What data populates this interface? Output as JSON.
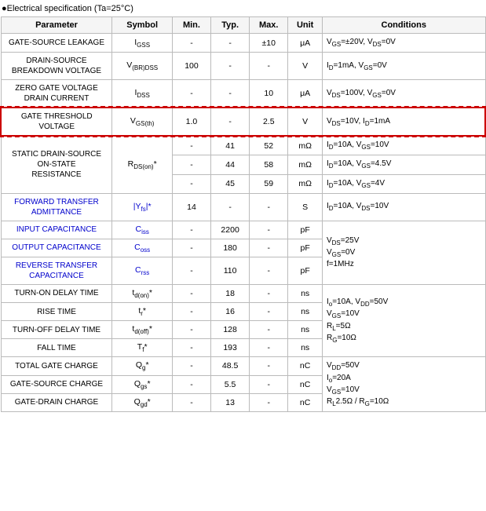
{
  "header": {
    "title": "●Electrical specification (Ta=25°C)"
  },
  "table": {
    "columns": [
      "Parameter",
      "Symbol",
      "Min.",
      "Typ.",
      "Max.",
      "Unit",
      "Conditions"
    ],
    "rows": [
      {
        "id": "gate-source-leakage",
        "param": "GATE-SOURCE LEAKAGE",
        "symbol": "IGSS",
        "min": "-",
        "typ": "-",
        "max": "±10",
        "unit": "μA",
        "conditions": "VGS=±20V, VDS=0V",
        "highlight": false,
        "blue": false,
        "colspan_param": 1
      },
      {
        "id": "drain-source-breakdown",
        "param": "DRAIN-SOURCE BREAKDOWN VOLTAGE",
        "symbol": "V(BR)DSS",
        "min": "100",
        "typ": "-",
        "max": "-",
        "unit": "V",
        "conditions": "ID=1mA, VGS=0V",
        "highlight": false,
        "blue": false
      },
      {
        "id": "zero-gate-voltage",
        "param": "ZERO GATE VOLTAGE DRAIN CURRENT",
        "symbol": "IDSS",
        "min": "-",
        "typ": "-",
        "max": "10",
        "unit": "μA",
        "conditions": "VDS=100V, VGS=0V",
        "highlight": false,
        "blue": false
      },
      {
        "id": "gate-threshold",
        "param": "GATE THRESHOLD VOLTAGE",
        "symbol": "VGS(th)",
        "min": "1.0",
        "typ": "-",
        "max": "2.5",
        "unit": "V",
        "conditions": "VDS=10V, ID=1mA",
        "highlight": true,
        "blue": false
      },
      {
        "id": "static-drain-1",
        "param": "STATIC DRAIN-SOURCE ON-STATE RESISTANCE",
        "symbol": "RDS(on)*",
        "min": "-",
        "typ": "41",
        "max": "52",
        "unit": "mΩ",
        "conditions": "ID=10A, VGS=10V",
        "highlight": false,
        "blue": false,
        "row_span": 3,
        "row_index": 0
      },
      {
        "id": "static-drain-2",
        "param": null,
        "symbol": null,
        "min": "-",
        "typ": "44",
        "max": "58",
        "unit": "mΩ",
        "conditions": "ID=10A, VGS=4.5V",
        "highlight": false,
        "blue": false,
        "row_span": 3,
        "row_index": 1
      },
      {
        "id": "static-drain-3",
        "param": null,
        "symbol": null,
        "min": "-",
        "typ": "45",
        "max": "59",
        "unit": "mΩ",
        "conditions": "ID=10A, VGS=4V",
        "highlight": false,
        "blue": false,
        "row_span": 3,
        "row_index": 2
      },
      {
        "id": "forward-transfer",
        "param": "FORWARD TRANSFER ADMITTANCE",
        "symbol": "|Yfs|*",
        "min": "14",
        "typ": "-",
        "max": "-",
        "unit": "S",
        "conditions": "ID=10A, VDS=10V",
        "highlight": false,
        "blue": true
      },
      {
        "id": "input-capacitance",
        "param": "INPUT CAPACITANCE",
        "symbol": "Ciss",
        "min": "-",
        "typ": "2200",
        "max": "-",
        "unit": "pF",
        "conditions": "",
        "highlight": false,
        "blue": true,
        "conditions_rowspan": 3
      },
      {
        "id": "output-capacitance",
        "param": "OUTPUT CAPACITANCE",
        "symbol": "Coss",
        "min": "-",
        "typ": "180",
        "max": "-",
        "unit": "pF",
        "conditions": "",
        "highlight": false,
        "blue": true
      },
      {
        "id": "reverse-transfer",
        "param": "REVERSE TRANSFER CAPACITANCE",
        "symbol": "Crss",
        "min": "-",
        "typ": "110",
        "max": "-",
        "unit": "pF",
        "conditions": "",
        "highlight": false,
        "blue": true
      },
      {
        "id": "turn-on-delay",
        "param": "TURN-ON DELAY TIME",
        "symbol": "td(on)*",
        "min": "-",
        "typ": "18",
        "max": "-",
        "unit": "ns",
        "conditions": "",
        "highlight": false,
        "blue": false,
        "conditions_rowspan": 4
      },
      {
        "id": "rise-time",
        "param": "RISE TIME",
        "symbol": "tr*",
        "min": "-",
        "typ": "16",
        "max": "-",
        "unit": "ns",
        "conditions": "",
        "highlight": false,
        "blue": false
      },
      {
        "id": "turn-off-delay",
        "param": "TURN-OFF DELAY TIME",
        "symbol": "td(off)*",
        "min": "-",
        "typ": "128",
        "max": "-",
        "unit": "ns",
        "conditions": "",
        "highlight": false,
        "blue": false
      },
      {
        "id": "fall-time",
        "param": "FALL TIME",
        "symbol": "Tf*",
        "min": "-",
        "typ": "193",
        "max": "-",
        "unit": "ns",
        "conditions": "",
        "highlight": false,
        "blue": false
      },
      {
        "id": "total-gate-charge",
        "param": "TOTAL GATE CHARGE",
        "symbol": "Qg*",
        "min": "-",
        "typ": "48.5",
        "max": "-",
        "unit": "nC",
        "conditions": "",
        "highlight": false,
        "blue": false,
        "conditions_rowspan": 3
      },
      {
        "id": "gate-source-charge",
        "param": "GATE-SOURCE CHARGE",
        "symbol": "Qgs*",
        "min": "-",
        "typ": "5.5",
        "max": "-",
        "unit": "nC",
        "conditions": "",
        "highlight": false,
        "blue": false
      },
      {
        "id": "gate-drain-charge",
        "param": "GATE-DRAIN CHARGE",
        "symbol": "Qgd*",
        "min": "-",
        "typ": "13",
        "max": "-",
        "unit": "nC",
        "conditions": "",
        "highlight": false,
        "blue": false
      }
    ]
  }
}
